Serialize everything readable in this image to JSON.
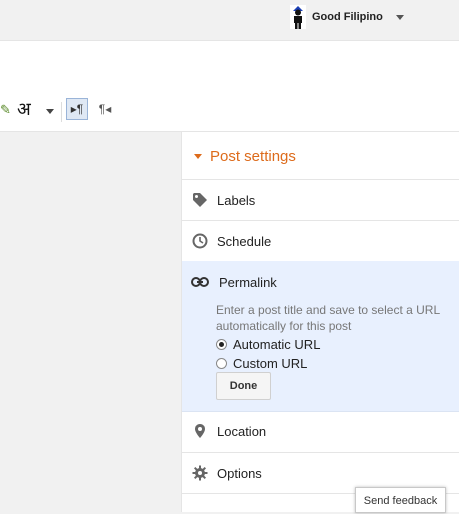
{
  "header": {
    "user_name": "Good Filipino"
  },
  "toolbar": {
    "language_glyph": "अ",
    "ltr_glyph": "▸¶",
    "rtl_glyph": "¶◂"
  },
  "post_settings": {
    "title": "Post settings",
    "items": [
      {
        "label": "Labels",
        "icon": "tag-icon"
      },
      {
        "label": "Schedule",
        "icon": "clock-icon"
      },
      {
        "label": "Permalink",
        "icon": "link-icon"
      },
      {
        "label": "Location",
        "icon": "location-pin-icon"
      },
      {
        "label": "Options",
        "icon": "gear-icon"
      }
    ],
    "permalink": {
      "description": "Enter a post title and save to select a URL automatically for this post",
      "options": [
        {
          "label": "Automatic URL",
          "checked": true
        },
        {
          "label": "Custom URL",
          "checked": false
        }
      ],
      "done_label": "Done"
    }
  },
  "feedback": {
    "label": "Send feedback"
  },
  "colors": {
    "accent_orange": "#dd6b1b",
    "permalink_bg": "#e8f0fe"
  }
}
